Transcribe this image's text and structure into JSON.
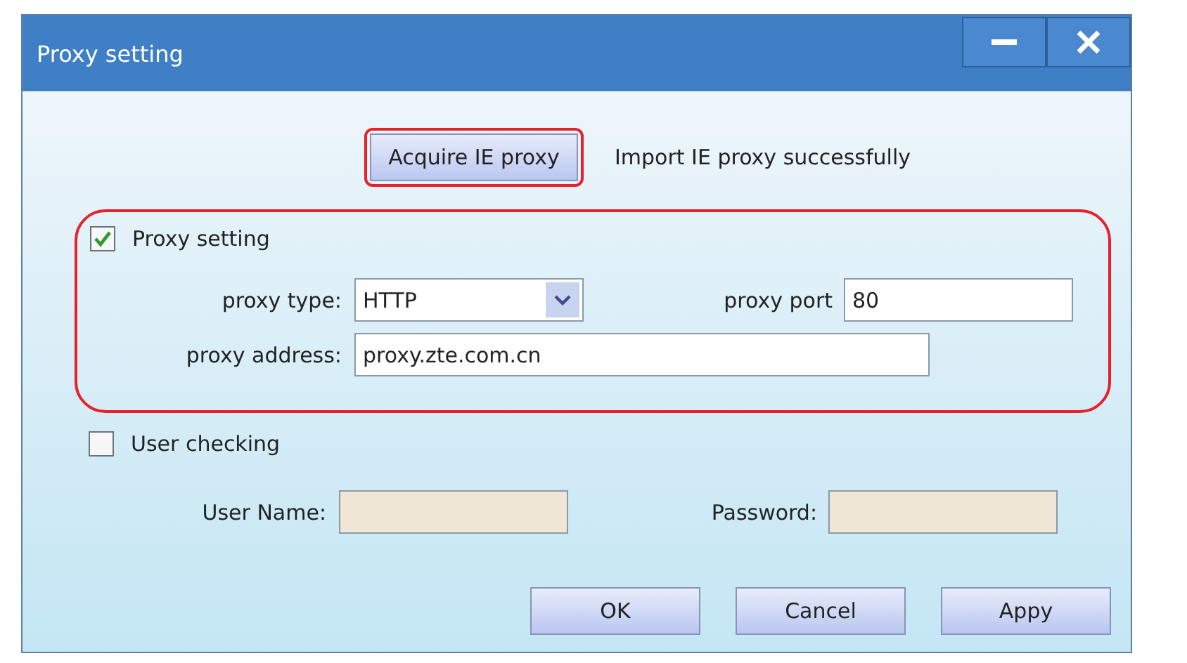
{
  "window": {
    "title": "Proxy setting"
  },
  "acquire_button": {
    "label": "Acquire IE proxy"
  },
  "status_message": "Import IE  proxy successfully",
  "proxy_setting": {
    "label": "Proxy setting",
    "checked": true,
    "proxy_type": {
      "label": "proxy type:",
      "value": "HTTP"
    },
    "proxy_port": {
      "label": "proxy port",
      "value": "80"
    },
    "proxy_address": {
      "label": "proxy address:",
      "value": "proxy.zte.com.cn"
    }
  },
  "user_checking": {
    "label": "User checking",
    "checked": false,
    "user_name": {
      "label": "User Name:",
      "disabled": true
    },
    "password": {
      "label": "Password:",
      "disabled": true
    }
  },
  "buttons": [
    "OK",
    "Cancel",
    "Appy"
  ]
}
